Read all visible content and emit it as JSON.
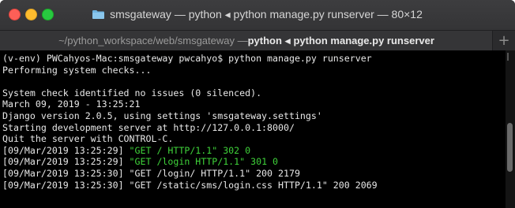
{
  "window": {
    "title": "smsgateway — python ◂ python manage.py runserver — 80×12"
  },
  "tab": {
    "path": "~/python_workspace/web/smsgateway — ",
    "proc1": "python",
    "sep": "◂",
    "proc2": "python manage.py runserver",
    "new_tab_label": "+"
  },
  "terminal": {
    "lines": [
      {
        "parts": [
          {
            "text": "(v-env) PWCahyos-Mac:smsgateway pwcahyo$ python manage.py runserver",
            "color": "default"
          }
        ]
      },
      {
        "parts": [
          {
            "text": "Performing system checks...",
            "color": "default"
          }
        ]
      },
      {
        "parts": [
          {
            "text": "",
            "color": "default"
          }
        ]
      },
      {
        "parts": [
          {
            "text": "System check identified no issues (0 silenced).",
            "color": "default"
          }
        ]
      },
      {
        "parts": [
          {
            "text": "March 09, 2019 - 13:25:21",
            "color": "default"
          }
        ]
      },
      {
        "parts": [
          {
            "text": "Django version 2.0.5, using settings 'smsgateway.settings'",
            "color": "default"
          }
        ]
      },
      {
        "parts": [
          {
            "text": "Starting development server at http://127.0.0.1:8000/",
            "color": "default"
          }
        ]
      },
      {
        "parts": [
          {
            "text": "Quit the server with CONTROL-C.",
            "color": "default"
          }
        ]
      },
      {
        "parts": [
          {
            "text": "[09/Mar/2019 13:25:29] ",
            "color": "default"
          },
          {
            "text": "\"GET / HTTP/1.1\" 302 0",
            "color": "green"
          }
        ]
      },
      {
        "parts": [
          {
            "text": "[09/Mar/2019 13:25:29] ",
            "color": "default"
          },
          {
            "text": "\"GET /login HTTP/1.1\" 301 0",
            "color": "green"
          }
        ]
      },
      {
        "parts": [
          {
            "text": "[09/Mar/2019 13:25:30] \"GET /login/ HTTP/1.1\" 200 2179",
            "color": "default"
          }
        ]
      },
      {
        "parts": [
          {
            "text": "[09/Mar/2019 13:25:30] \"GET /static/sms/login.css HTTP/1.1\" 200 2069",
            "color": "default"
          }
        ]
      }
    ]
  },
  "colors": {
    "default_text": "#e8e8e8",
    "green_text": "#3fd33a",
    "background": "#000000"
  },
  "icons": {
    "folder": "folder-icon"
  }
}
